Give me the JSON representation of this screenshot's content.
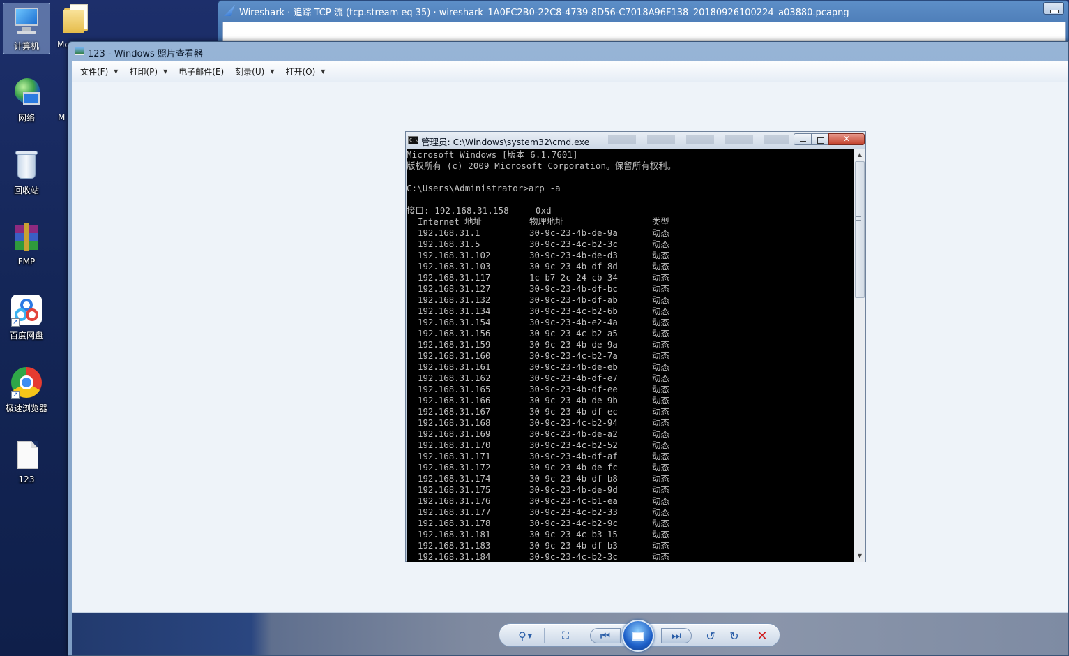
{
  "desktop": {
    "icons": [
      {
        "label": "计算机",
        "icon": "computer-icon"
      },
      {
        "label": "网络",
        "icon": "network-icon"
      },
      {
        "label": "回收站",
        "icon": "recycle-bin-icon"
      },
      {
        "label": "FMP",
        "icon": "winrar-archive-icon"
      },
      {
        "label": "百度网盘",
        "icon": "baidu-netdisk-icon"
      },
      {
        "label": "极速浏览器",
        "icon": "browser-icon"
      },
      {
        "label": "123",
        "icon": "file-icon"
      }
    ],
    "partial_labels": [
      "Mc",
      "M"
    ]
  },
  "wireshark": {
    "title": "Wireshark · 追踪 TCP 流 (tcp.stream eq 35) · wireshark_1A0FC2B0-22C8-4739-8D56-C7018A96F138_20180926100224_a03880.pcapng"
  },
  "viewer": {
    "title": "123 - Windows 照片查看器",
    "menu": [
      {
        "label": "文件(F)",
        "has_arrow": true
      },
      {
        "label": "打印(P)",
        "has_arrow": true
      },
      {
        "label": "电子邮件(E)",
        "has_arrow": false
      },
      {
        "label": "刻录(U)",
        "has_arrow": true
      },
      {
        "label": "打开(O)",
        "has_arrow": true
      }
    ],
    "controls": [
      "zoom-icon",
      "fit-window-icon",
      "previous-icon",
      "slideshow-icon",
      "next-icon",
      "rotate-left-icon",
      "rotate-right-icon",
      "delete-icon"
    ]
  },
  "cmd": {
    "title": "管理员: C:\\Windows\\system32\\cmd.exe",
    "icon_text": "C:\\",
    "close_glyph": "✕",
    "header_lines": [
      "Microsoft Windows [版本 6.1.7601]",
      "版权所有 (c) 2009 Microsoft Corporation。保留所有权利。",
      "",
      "C:\\Users\\Administrator>arp -a",
      "",
      "接口: 192.168.31.158 --- 0xd"
    ],
    "columns": {
      "ip": "Internet 地址",
      "mac": "物理地址",
      "type": "类型"
    },
    "entries": [
      {
        "ip": "192.168.31.1",
        "mac": "30-9c-23-4b-de-9a",
        "type": "动态"
      },
      {
        "ip": "192.168.31.5",
        "mac": "30-9c-23-4c-b2-3c",
        "type": "动态"
      },
      {
        "ip": "192.168.31.102",
        "mac": "30-9c-23-4b-de-d3",
        "type": "动态"
      },
      {
        "ip": "192.168.31.103",
        "mac": "30-9c-23-4b-df-8d",
        "type": "动态"
      },
      {
        "ip": "192.168.31.117",
        "mac": "1c-b7-2c-24-cb-34",
        "type": "动态"
      },
      {
        "ip": "192.168.31.127",
        "mac": "30-9c-23-4b-df-bc",
        "type": "动态"
      },
      {
        "ip": "192.168.31.132",
        "mac": "30-9c-23-4b-df-ab",
        "type": "动态"
      },
      {
        "ip": "192.168.31.134",
        "mac": "30-9c-23-4c-b2-6b",
        "type": "动态"
      },
      {
        "ip": "192.168.31.154",
        "mac": "30-9c-23-4b-e2-4a",
        "type": "动态"
      },
      {
        "ip": "192.168.31.156",
        "mac": "30-9c-23-4c-b2-a5",
        "type": "动态"
      },
      {
        "ip": "192.168.31.159",
        "mac": "30-9c-23-4b-de-9a",
        "type": "动态"
      },
      {
        "ip": "192.168.31.160",
        "mac": "30-9c-23-4c-b2-7a",
        "type": "动态"
      },
      {
        "ip": "192.168.31.161",
        "mac": "30-9c-23-4b-de-eb",
        "type": "动态"
      },
      {
        "ip": "192.168.31.162",
        "mac": "30-9c-23-4b-df-e7",
        "type": "动态"
      },
      {
        "ip": "192.168.31.165",
        "mac": "30-9c-23-4b-df-ee",
        "type": "动态"
      },
      {
        "ip": "192.168.31.166",
        "mac": "30-9c-23-4b-de-9b",
        "type": "动态"
      },
      {
        "ip": "192.168.31.167",
        "mac": "30-9c-23-4b-df-ec",
        "type": "动态"
      },
      {
        "ip": "192.168.31.168",
        "mac": "30-9c-23-4c-b2-94",
        "type": "动态"
      },
      {
        "ip": "192.168.31.169",
        "mac": "30-9c-23-4b-de-a2",
        "type": "动态"
      },
      {
        "ip": "192.168.31.170",
        "mac": "30-9c-23-4c-b2-52",
        "type": "动态"
      },
      {
        "ip": "192.168.31.171",
        "mac": "30-9c-23-4b-df-af",
        "type": "动态"
      },
      {
        "ip": "192.168.31.172",
        "mac": "30-9c-23-4b-de-fc",
        "type": "动态"
      },
      {
        "ip": "192.168.31.174",
        "mac": "30-9c-23-4b-df-b8",
        "type": "动态"
      },
      {
        "ip": "192.168.31.175",
        "mac": "30-9c-23-4b-de-9d",
        "type": "动态"
      },
      {
        "ip": "192.168.31.176",
        "mac": "30-9c-23-4c-b1-ea",
        "type": "动态"
      },
      {
        "ip": "192.168.31.177",
        "mac": "30-9c-23-4c-b2-33",
        "type": "动态"
      },
      {
        "ip": "192.168.31.178",
        "mac": "30-9c-23-4c-b2-9c",
        "type": "动态"
      },
      {
        "ip": "192.168.31.181",
        "mac": "30-9c-23-4c-b3-15",
        "type": "动态"
      },
      {
        "ip": "192.168.31.183",
        "mac": "30-9c-23-4b-df-b3",
        "type": "动态"
      },
      {
        "ip": "192.168.31.184",
        "mac": "30-9c-23-4c-b2-3c",
        "type": "动态"
      }
    ]
  }
}
